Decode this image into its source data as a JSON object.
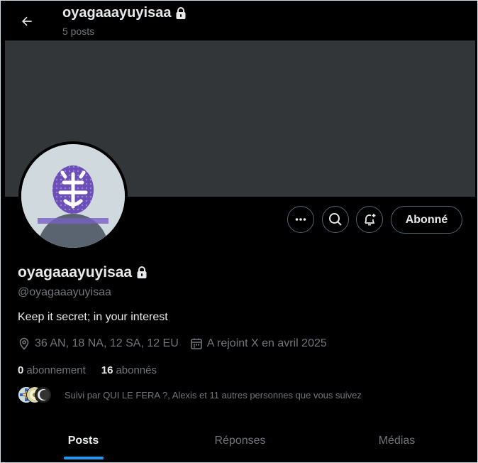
{
  "header": {
    "title": "oyagaaayuyisaa",
    "subtitle": "5 posts"
  },
  "profile": {
    "name": "oyagaaayuyisaa",
    "handle": "@oyagaaayuyisaa",
    "bio": "Keep it secret; in your interest",
    "location": "36 AN, 18 NA, 12 SA, 12 EU",
    "joined": "A rejoint X en avril 2025"
  },
  "actions": {
    "follow_label": "Abonné"
  },
  "counts": {
    "following_value": "0",
    "following_label": "abonnement",
    "followers_value": "16",
    "followers_label": "abonnés"
  },
  "followed_by": "Suivi par QUI LE FERA ?, Alexis et 11 autres personnes que vous suivez",
  "tabs": [
    {
      "label": "Posts",
      "active": true
    },
    {
      "label": "Réponses",
      "active": false
    },
    {
      "label": "Médias",
      "active": false
    }
  ],
  "colors": {
    "background": "#000000",
    "banner": "#333639",
    "accent": "#1d9bf0",
    "muted_text": "#71767b",
    "primary_text": "#e7e9ea"
  },
  "icons": {
    "back": "arrow-left-icon",
    "lock": "lock-icon",
    "more": "more-icon",
    "search": "search-icon",
    "notify": "bell-plus-icon",
    "location": "location-pin-icon",
    "calendar": "calendar-icon"
  }
}
